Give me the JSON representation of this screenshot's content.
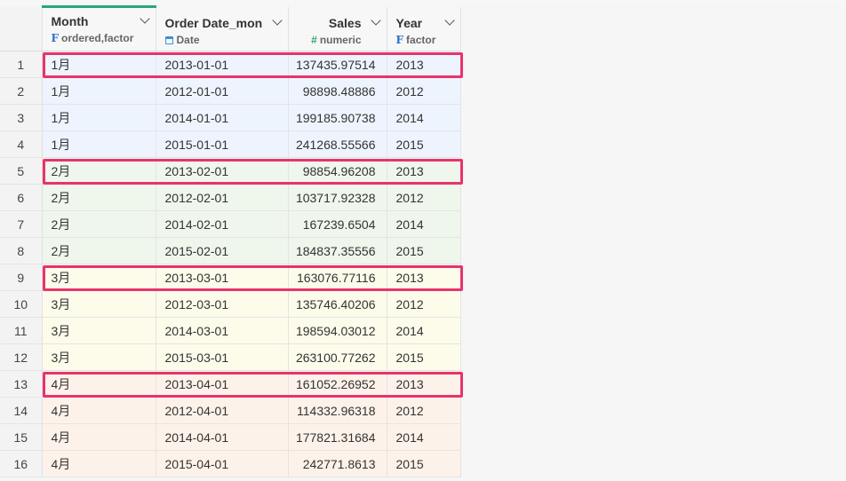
{
  "columns": [
    {
      "name": "Month",
      "type_symbol": "F",
      "type_label": "ordered,factor"
    },
    {
      "name": "Order Date_mon",
      "type_symbol": "calendar-icon",
      "type_label": "Date"
    },
    {
      "name": "Sales",
      "type_symbol": "#",
      "type_label": "numeric"
    },
    {
      "name": "Year",
      "type_symbol": "F",
      "type_label": "factor"
    }
  ],
  "rows": [
    {
      "n": "1",
      "month": "1月",
      "date": "2013-01-01",
      "sales": "137435.97514",
      "year": "2013"
    },
    {
      "n": "2",
      "month": "1月",
      "date": "2012-01-01",
      "sales": "98898.48886",
      "year": "2012"
    },
    {
      "n": "3",
      "month": "1月",
      "date": "2014-01-01",
      "sales": "199185.90738",
      "year": "2014"
    },
    {
      "n": "4",
      "month": "1月",
      "date": "2015-01-01",
      "sales": "241268.55566",
      "year": "2015"
    },
    {
      "n": "5",
      "month": "2月",
      "date": "2013-02-01",
      "sales": "98854.96208",
      "year": "2013"
    },
    {
      "n": "6",
      "month": "2月",
      "date": "2012-02-01",
      "sales": "103717.92328",
      "year": "2012"
    },
    {
      "n": "7",
      "month": "2月",
      "date": "2014-02-01",
      "sales": "167239.6504",
      "year": "2014"
    },
    {
      "n": "8",
      "month": "2月",
      "date": "2015-02-01",
      "sales": "184837.35556",
      "year": "2015"
    },
    {
      "n": "9",
      "month": "3月",
      "date": "2013-03-01",
      "sales": "163076.77116",
      "year": "2013"
    },
    {
      "n": "10",
      "month": "3月",
      "date": "2012-03-01",
      "sales": "135746.40206",
      "year": "2012"
    },
    {
      "n": "11",
      "month": "3月",
      "date": "2014-03-01",
      "sales": "198594.03012",
      "year": "2014"
    },
    {
      "n": "12",
      "month": "3月",
      "date": "2015-03-01",
      "sales": "263100.77262",
      "year": "2015"
    },
    {
      "n": "13",
      "month": "4月",
      "date": "2013-04-01",
      "sales": "161052.26952",
      "year": "2013"
    },
    {
      "n": "14",
      "month": "4月",
      "date": "2012-04-01",
      "sales": "114332.96318",
      "year": "2012"
    },
    {
      "n": "15",
      "month": "4月",
      "date": "2014-04-01",
      "sales": "177821.31684",
      "year": "2014"
    },
    {
      "n": "16",
      "month": "4月",
      "date": "2015-04-01",
      "sales": "242771.8613",
      "year": "2015"
    }
  ],
  "colors": {
    "active_tab": "#27a77a",
    "highlight": "#e8336c",
    "jan_group": "#eef4fd",
    "feb_group": "#eff6ec",
    "mar_group": "#fdfceb",
    "apr_group": "#fdf2ea"
  },
  "highlighted_rows": [
    "1",
    "5",
    "9",
    "13"
  ]
}
